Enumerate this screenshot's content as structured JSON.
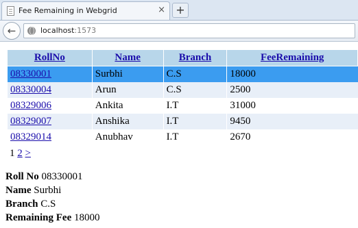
{
  "browser": {
    "tab_title": "Fee Remaining in Webgrid",
    "tab_close": "×",
    "new_tab": "+",
    "back": "←",
    "url_host": "localhost",
    "url_port": ":1573"
  },
  "grid": {
    "headers": [
      "RollNo",
      "Name",
      "Branch",
      "FeeRemaining"
    ],
    "rows": [
      {
        "rollno": "08330001",
        "name": "Surbhi",
        "branch": "C.S",
        "fee": "18000",
        "selected": true
      },
      {
        "rollno": "08330004",
        "name": "Arun",
        "branch": "C.S",
        "fee": "2500",
        "selected": false
      },
      {
        "rollno": "08329006",
        "name": "Ankita",
        "branch": "I.T",
        "fee": "31000",
        "selected": false
      },
      {
        "rollno": "08329007",
        "name": "Anshika",
        "branch": "I.T",
        "fee": "9450",
        "selected": false
      },
      {
        "rollno": "08329014",
        "name": "Anubhav",
        "branch": "I.T",
        "fee": "2670",
        "selected": false
      }
    ],
    "pager": {
      "current": "1",
      "page2": "2",
      "next": ">"
    }
  },
  "details": {
    "roll_label": "Roll No",
    "roll_value": "08330001",
    "name_label": "Name",
    "name_value": "Surbhi",
    "branch_label": "Branch",
    "branch_value": "C.S",
    "fee_label": "Remaining Fee",
    "fee_value": "18000"
  },
  "colors": {
    "header_bg": "#b8d6ea",
    "selected_row": "#3b9cf0",
    "alt_row": "#e8eff8",
    "link": "#1a0dab"
  }
}
